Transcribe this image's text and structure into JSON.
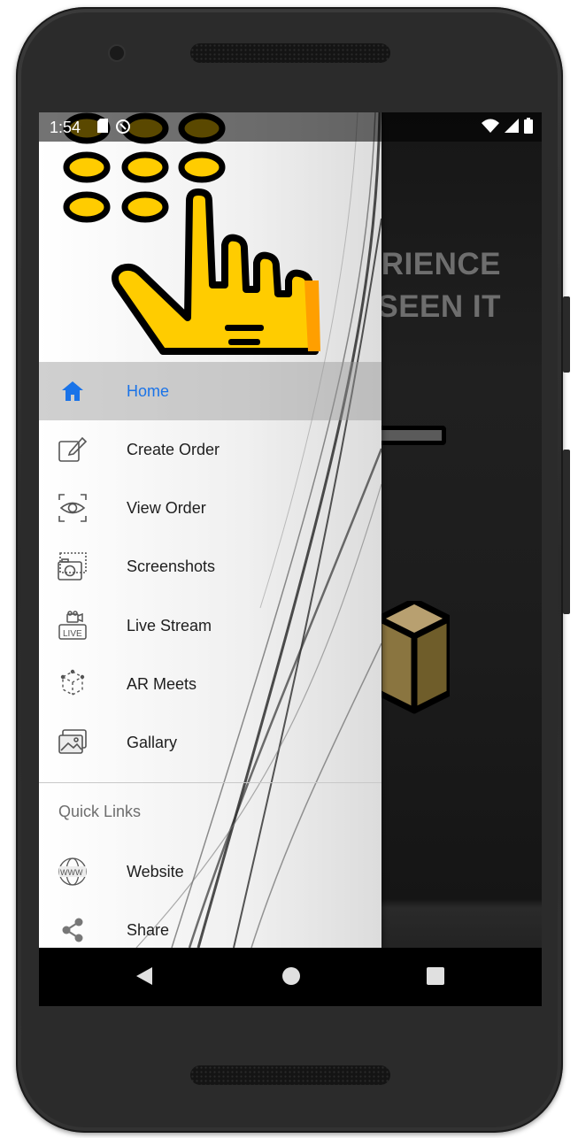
{
  "status_bar": {
    "time": "1:54"
  },
  "background_app": {
    "line1": "ERIENCE",
    "line2": "SEEN IT"
  },
  "drawer": {
    "main_items": [
      {
        "label": "Home",
        "icon": "home-icon",
        "active": true
      },
      {
        "label": "Create Order",
        "icon": "edit-icon",
        "active": false
      },
      {
        "label": "View Order",
        "icon": "eye-icon",
        "active": false
      },
      {
        "label": "Screenshots",
        "icon": "camera-icon",
        "active": false
      },
      {
        "label": "Live Stream",
        "icon": "live-stream-icon",
        "active": false
      },
      {
        "label": "AR Meets",
        "icon": "ar-cube-icon",
        "active": false
      },
      {
        "label": "Gallary",
        "icon": "gallery-icon",
        "active": false
      }
    ],
    "quick_links_title": "Quick Links",
    "quick_links": [
      {
        "label": "Website",
        "icon": "www-globe-icon"
      },
      {
        "label": "Share",
        "icon": "share-icon"
      }
    ]
  },
  "colors": {
    "active": "#1a73e8",
    "logo_yellow": "#ffcc00",
    "logo_dark_yellow": "#c8a000"
  }
}
